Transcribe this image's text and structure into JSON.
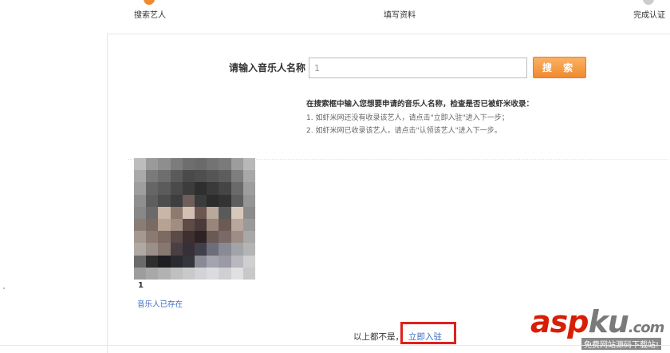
{
  "steps": [
    {
      "label": "搜索艺人",
      "color": "#f08a2f"
    },
    {
      "label": "填写资料",
      "color": "#cccccc"
    },
    {
      "label": "完成认证",
      "color": "#cccccc"
    }
  ],
  "search": {
    "label": "请输入音乐人名称",
    "value": "1",
    "button_label": "搜 索"
  },
  "tips": {
    "title": "在搜索框中输入您想要申请的音乐人名称，检查是否已被虾米收录：",
    "lines": [
      "1. 如虾米网还没有收录该艺人，请点击\"立即入驻\"进入下一步；",
      "2. 如虾米网已收录该艺人，请点击\"认领该艺人\"进入下一步。"
    ]
  },
  "result": {
    "name": "1",
    "status": "音乐人已存在"
  },
  "footer": {
    "text": "以上都不是，",
    "join_link": "立即入驻"
  },
  "watermark": {
    "brand_red": "asp",
    "brand_gray": "ku",
    "domain": ".com",
    "subtitle": "免费网站源码下载站!"
  },
  "colors": {
    "accent": "#f08a2f",
    "link": "#3a6cc0",
    "highlight": "#e02020"
  }
}
